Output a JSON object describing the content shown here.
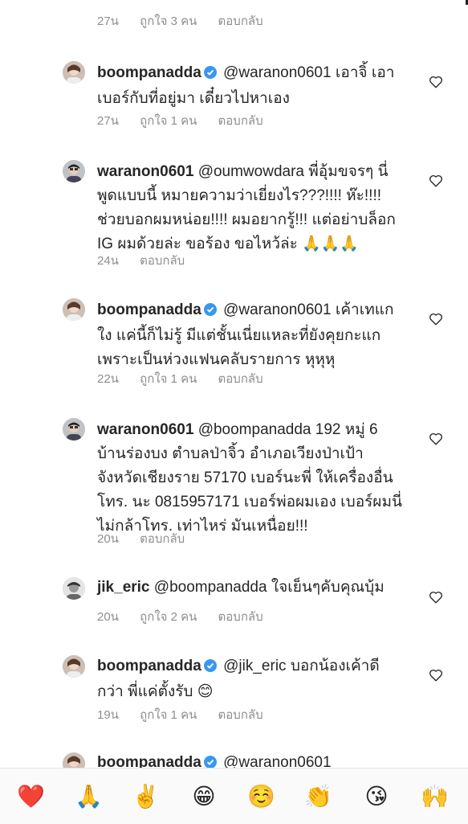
{
  "top_meta": {
    "time": "27น",
    "likes": "ถูกใจ 3 คน",
    "reply": "ตอบกลับ"
  },
  "comments": [
    {
      "username": "boompanadda",
      "verified": true,
      "lines": [
        "@waranon0601 เอาจิ้ เอา",
        "เบอร์กับที่อยู่มา เดี๋ยวไปหาเอง"
      ],
      "time": "27น",
      "likes": "ถูกใจ 1 คน",
      "reply": "ตอบกลับ"
    },
    {
      "username": "waranon0601",
      "verified": false,
      "lines": [
        "@oumwowdara พี่อุ้มขจรๆ นี่",
        "พูดแบบนี้ หมายความว่าเยี่ยงไร???!!!! ห๊ะ!!!!",
        "ช่วยบอกผมหน่อย!!!! ผมอยากรู้!!! แต่อย่าบล็อก",
        "IG ผมด้วยล่ะ ขอร้อง ขอไหว้ล่ะ 🙏🙏🙏"
      ],
      "time": "24น",
      "reply": "ตอบกลับ"
    },
    {
      "username": "boompanadda",
      "verified": true,
      "lines": [
        "@waranon0601 เค้าเทแก",
        "ใง แค่นี้ก็ไม่รู้ มีแต่ชั้นเนี่ยแหละที่ยังคุยกะแก",
        "เพราะเป็นห่วงแฟนคลับรายการ หุหุหุ"
      ],
      "time": "22น",
      "likes": "ถูกใจ 1 คน",
      "reply": "ตอบกลับ"
    },
    {
      "username": "waranon0601",
      "verified": false,
      "lines": [
        "@boompanadda 192 หมู่ 6",
        "บ้านร่องบง ตำบลป่าจิ้ว อำเภอเวียงป่าเป้า",
        "จังหวัดเชียงราย 57170 เบอร์นะพี่ ให้เครื่องอื่น",
        "โทร. นะ 0815957171 เบอร์พ่อผมเอง เบอร์ผมนี่",
        "ไม่กล้าโทร. เท่าไหร่ มันเหนื่อย!!!"
      ],
      "time": "20น",
      "reply": "ตอบกลับ"
    },
    {
      "username": "jik_eric",
      "verified": false,
      "lines": [
        "@boompanadda ใจเย็นๆคับคุณบุ้ม"
      ],
      "time": "20น",
      "likes": "ถูกใจ 2 คน",
      "reply": "ตอบกลับ"
    },
    {
      "username": "boompanadda",
      "verified": true,
      "lines": [
        "@jik_eric บอกน้องเค้าดี",
        "กว่า พี่แค่ตั้งรับ 😊"
      ],
      "time": "19น",
      "likes": "ถูกใจ 1 คน",
      "reply": "ตอบกลับ"
    },
    {
      "username": "boompanadda",
      "verified": true,
      "lines": [
        "@waranon0601"
      ]
    }
  ],
  "emoji_bar": [
    "❤️",
    "🙏",
    "✌️",
    "😁",
    "☺️",
    "👏",
    "😘",
    "🙌"
  ],
  "icons": {
    "heart": "heart-outline-icon",
    "verified": "verified-badge-icon",
    "verified_color": "#3897f0",
    "text_color": "#262626",
    "meta_color": "#8e8e8e"
  }
}
